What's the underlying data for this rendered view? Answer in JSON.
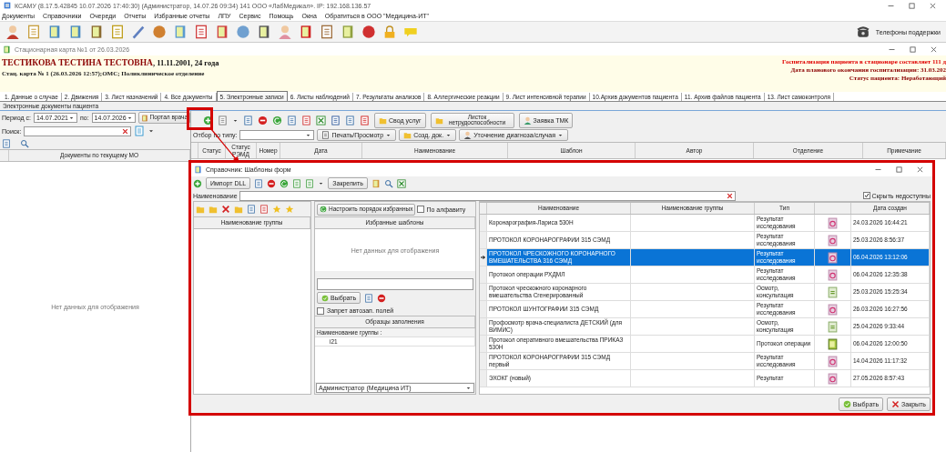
{
  "app": {
    "title": "КСАМУ (8.17.5.42845 10.07.2026 17:40:30) (Администратор, 14.07.26 09:34)  141 ООО «ЛабМедикал». IP: 192.168.136.57",
    "menu": [
      "Документы",
      "Справочники",
      "Очереди",
      "Отчеты",
      "Избранные отчеты",
      "ЛПУ",
      "Сервис",
      "Помощь",
      "Окна",
      "Обратиться в ООО \"Медицина-ИТ\""
    ],
    "support": "Телефоны поддержки"
  },
  "card": {
    "title": "Стационарная карта №1 от 26.03.2026",
    "patient_name": "ТЕСТИКОВА ТЕСТИНА ТЕСТОВНА",
    "patient_info": ", 11.11.2001, 24 года",
    "card_line": "Стац. карта  № 1 (26.03.2026 12:57);ОМС; Поликлиническое отделение",
    "notices": [
      {
        "text": "Госпитализация пациента в стационаре составляет 111 д",
        "kind": "alert"
      },
      {
        "text": "Дата планового окончания госпитализации: 31.03.202",
        "kind": "info"
      },
      {
        "text": "Статус пациента: Неработающий",
        "kind": "info"
      }
    ]
  },
  "tabs": [
    {
      "label": "1. Данные о случае",
      "selected": false
    },
    {
      "label": "2. Движения",
      "selected": false
    },
    {
      "label": "3. Лист назначений",
      "selected": false
    },
    {
      "label": "4. Все документы",
      "selected": false
    },
    {
      "label": "5. Электронные записи",
      "selected": true
    },
    {
      "label": "6. Листы наблюдений",
      "selected": false
    },
    {
      "label": "7. Результаты анализов",
      "selected": false
    },
    {
      "label": "8. Аллергические реакции",
      "selected": false
    },
    {
      "label": "9. Лист интенсивной терапии",
      "selected": false
    },
    {
      "label": "10.Архив документов пациента",
      "selected": false
    },
    {
      "label": "11. Архив файлов пациента",
      "selected": false
    },
    {
      "label": "13. Лист самоконтроля",
      "selected": false
    }
  ],
  "documents": {
    "group_title": "Электронные документы пациента",
    "period_label": "Период с:",
    "date_from": "14.07.2021",
    "to_label": "по:",
    "date_to": "14.07.2026",
    "portal_button": "Портал врача",
    "search_label": "Поиск:",
    "list_header": "Документы по текущему МО",
    "empty": "Нет данных для отображения",
    "toolbar_buttons": [
      "Свод услуг",
      "Листок нетрудоспособности",
      "Заявка ТМК"
    ],
    "type_filter_label": "Отбор по типу:",
    "actions": [
      "Печать/Просмотр",
      "Созд. док.",
      "Уточнение диагноза/случая"
    ],
    "columns": [
      "Статус",
      "Статус РЭМД",
      "Номер",
      "Дата",
      "Наименование",
      "Шаблон",
      "Автор",
      "Отделение",
      "Примечание"
    ]
  },
  "dialog": {
    "title": "Справочник: Шаблоны форм",
    "import_button": "Импорт DLL",
    "pin_button": "Закрепить",
    "name_label": "Наименование",
    "hide_unavailable": {
      "label": "Скрыть недоступны",
      "checked": true
    },
    "groups_header": "Наименование группы",
    "favorites": {
      "order_button": "Настроить порядок избранных",
      "alphabet": {
        "label": "По алфавиту",
        "checked": false
      },
      "header": "Избранные шаблоны",
      "empty": "Нет данных для отображения"
    },
    "samples": {
      "select_button": "Выбрать",
      "no_autofill": {
        "label": "Запрет автозап. полей",
        "checked": false
      },
      "header": "Образцы заполнения",
      "group_row": "Наименование группы :",
      "rows": [
        "i21"
      ],
      "author": "Администратор (Медицина ИТ)"
    },
    "templates": {
      "columns": [
        "Наименование",
        "Наименование группы",
        "Тип",
        "Дата создан"
      ],
      "rows": [
        {
          "name": "Коронарография-Лариса 530Н",
          "type": "Результат исследования",
          "kind": "research",
          "date": "24.03.2026 16:44:21",
          "selected": false
        },
        {
          "name": "ПРОТОКОЛ КОРОНАРОГРАФИИ 315 СЭМД",
          "type": "Результат исследования",
          "kind": "research",
          "date": "25.03.2026 8:56:37",
          "selected": false
        },
        {
          "name": "ПРОТОКОЛ ЧРЕСКОЖНОГО КОРОНАРНОГО ВМЕШАТЕЛЬСТВА 316 СЭМД",
          "type": "Результат исследования",
          "kind": "research",
          "date": "06.04.2026 13:12:06",
          "selected": true
        },
        {
          "name": "Протокол операции РХДМЛ",
          "type": "Результат исследования",
          "kind": "research",
          "date": "06.04.2026 12:35:38",
          "selected": false
        },
        {
          "name": "Протокол чрескожного коронарного вмешательства Сгенерированный",
          "type": "Осмотр, консультация",
          "kind": "exam",
          "date": "25.03.2026 15:25:34",
          "selected": false
        },
        {
          "name": "ПРОТОКОЛ ШУНТОГРАФИИ 315 СЭМД",
          "type": "Результат исследования",
          "kind": "research",
          "date": "26.03.2026 16:27:56",
          "selected": false
        },
        {
          "name": "Профосмотр врача-специалиста ДЕТСКИЙ (для ВИМИС)",
          "type": "Осмотр, консультация",
          "kind": "exam",
          "date": "25.04.2026 9:33:44",
          "selected": false
        },
        {
          "name": "Протокол оперативного вмешательства ПРИКАЗ 530Н",
          "type": "Протокол операции",
          "kind": "protocol",
          "date": "06.04.2026 12:00:50",
          "selected": false
        },
        {
          "name": "ПРОТОКОЛ КОРОНАРОГРАФИИ 315 СЭМД первый",
          "type": "Результат исследования",
          "kind": "research",
          "date": "14.04.2026 11:17:32",
          "selected": false
        },
        {
          "name": "ЭХОКГ (новый)",
          "type": "Результат",
          "kind": "research",
          "date": "27.05.2026 8:57:43",
          "selected": false
        }
      ]
    },
    "footer_buttons": [
      "Выбрать",
      "Закрыть"
    ]
  }
}
